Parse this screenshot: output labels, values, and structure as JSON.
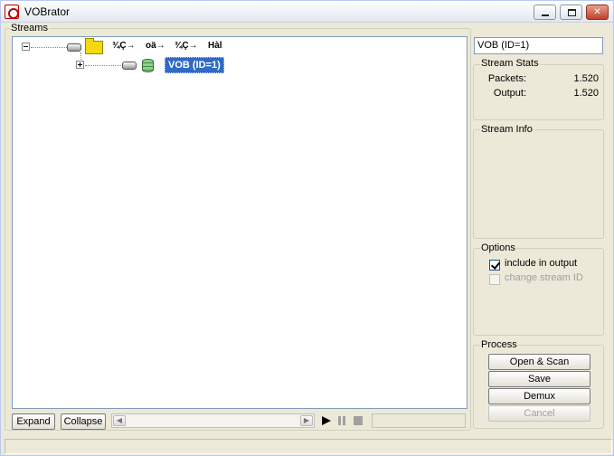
{
  "window": {
    "title": "VOBrator"
  },
  "streams": {
    "legend": "Streams",
    "tree": {
      "root_columns": [
        "¾Ç→",
        "oä→",
        "¾Ç→",
        "Hàl"
      ],
      "selected_node": "VOB (ID=1)"
    },
    "expand_label": "Expand",
    "collapse_label": "Collapse"
  },
  "right_panel": {
    "selected_name": "VOB (ID=1)",
    "stream_stats": {
      "legend": "Stream Stats",
      "packets_label": "Packets:",
      "packets_value": "1.520",
      "output_label": "Output:",
      "output_value": "1.520"
    },
    "stream_info": {
      "legend": "Stream Info"
    },
    "options": {
      "legend": "Options",
      "include_label": "include in output",
      "include_checked": true,
      "change_id_label": "change stream ID",
      "change_id_checked": false
    },
    "process": {
      "legend": "Process",
      "open_scan_label": "Open & Scan",
      "save_label": "Save",
      "demux_label": "Demux",
      "cancel_label": "Cancel"
    }
  }
}
